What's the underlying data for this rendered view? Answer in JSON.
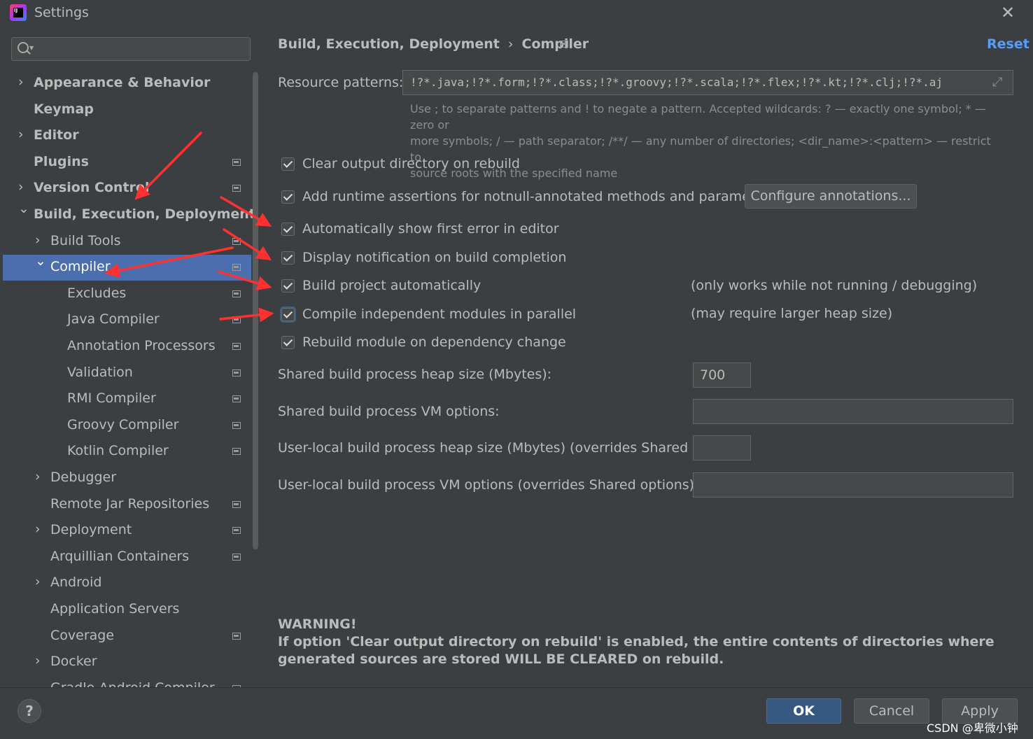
{
  "window": {
    "title": "Settings",
    "logo_text": "IJ"
  },
  "search": {
    "placeholder": "",
    "value": ""
  },
  "sidebar": {
    "items": [
      {
        "label": "Appearance & Behavior",
        "level": 0,
        "chevron": "right",
        "bold": true,
        "project_icon": false,
        "selected": false
      },
      {
        "label": "Keymap",
        "level": 0,
        "chevron": "none",
        "bold": true,
        "project_icon": false,
        "selected": false
      },
      {
        "label": "Editor",
        "level": 0,
        "chevron": "right",
        "bold": true,
        "project_icon": false,
        "selected": false
      },
      {
        "label": "Plugins",
        "level": 0,
        "chevron": "none",
        "bold": true,
        "project_icon": true,
        "selected": false
      },
      {
        "label": "Version Control",
        "level": 0,
        "chevron": "right",
        "bold": true,
        "project_icon": true,
        "selected": false
      },
      {
        "label": "Build, Execution, Deployment",
        "level": 0,
        "chevron": "down",
        "bold": true,
        "project_icon": false,
        "selected": false
      },
      {
        "label": "Build Tools",
        "level": 1,
        "chevron": "right",
        "bold": false,
        "project_icon": true,
        "selected": false
      },
      {
        "label": "Compiler",
        "level": 1,
        "chevron": "down",
        "bold": false,
        "project_icon": true,
        "selected": true
      },
      {
        "label": "Excludes",
        "level": 2,
        "chevron": "none",
        "bold": false,
        "project_icon": true,
        "selected": false
      },
      {
        "label": "Java Compiler",
        "level": 2,
        "chevron": "none",
        "bold": false,
        "project_icon": true,
        "selected": false
      },
      {
        "label": "Annotation Processors",
        "level": 2,
        "chevron": "none",
        "bold": false,
        "project_icon": true,
        "selected": false
      },
      {
        "label": "Validation",
        "level": 2,
        "chevron": "none",
        "bold": false,
        "project_icon": true,
        "selected": false
      },
      {
        "label": "RMI Compiler",
        "level": 2,
        "chevron": "none",
        "bold": false,
        "project_icon": true,
        "selected": false
      },
      {
        "label": "Groovy Compiler",
        "level": 2,
        "chevron": "none",
        "bold": false,
        "project_icon": true,
        "selected": false
      },
      {
        "label": "Kotlin Compiler",
        "level": 2,
        "chevron": "none",
        "bold": false,
        "project_icon": true,
        "selected": false
      },
      {
        "label": "Debugger",
        "level": 1,
        "chevron": "right",
        "bold": false,
        "project_icon": false,
        "selected": false
      },
      {
        "label": "Remote Jar Repositories",
        "level": 1,
        "chevron": "none",
        "bold": false,
        "project_icon": true,
        "selected": false
      },
      {
        "label": "Deployment",
        "level": 1,
        "chevron": "right",
        "bold": false,
        "project_icon": true,
        "selected": false
      },
      {
        "label": "Arquillian Containers",
        "level": 1,
        "chevron": "none",
        "bold": false,
        "project_icon": true,
        "selected": false
      },
      {
        "label": "Android",
        "level": 1,
        "chevron": "right",
        "bold": false,
        "project_icon": false,
        "selected": false
      },
      {
        "label": "Application Servers",
        "level": 1,
        "chevron": "none",
        "bold": false,
        "project_icon": false,
        "selected": false
      },
      {
        "label": "Coverage",
        "level": 1,
        "chevron": "none",
        "bold": false,
        "project_icon": true,
        "selected": false
      },
      {
        "label": "Docker",
        "level": 1,
        "chevron": "right",
        "bold": false,
        "project_icon": false,
        "selected": false
      },
      {
        "label": "Gradle-Android Compiler",
        "level": 1,
        "chevron": "none",
        "bold": false,
        "project_icon": true,
        "selected": false
      }
    ]
  },
  "breadcrumb": {
    "parent": "Build, Execution, Deployment",
    "separator": "›",
    "current": "Compiler"
  },
  "reset_label": "Reset",
  "resource_patterns": {
    "label": "Resource patterns:",
    "value": "!?*.java;!?*.form;!?*.class;!?*.groovy;!?*.scala;!?*.flex;!?*.kt;!?*.clj;!?*.aj",
    "help_line1": "Use ; to separate patterns and ! to negate a pattern. Accepted wildcards: ? — exactly one symbol; * — zero or",
    "help_line2": "more symbols; / — path separator; /**/ — any number of directories; <dir_name>:<pattern> — restrict to",
    "help_line3": "source roots with the specified name"
  },
  "options": [
    {
      "label": "Clear output directory on rebuild",
      "checked": true,
      "note": ""
    },
    {
      "label": "Add runtime assertions for notnull-annotated methods and parameters",
      "checked": true,
      "note": ""
    },
    {
      "label": "Automatically show first error in editor",
      "checked": true,
      "note": ""
    },
    {
      "label": "Display notification on build completion",
      "checked": true,
      "note": ""
    },
    {
      "label": "Build project automatically",
      "checked": true,
      "note": "(only works while not running / debugging)"
    },
    {
      "label": "Compile independent modules in parallel",
      "checked": true,
      "note": "(may require larger heap size)"
    },
    {
      "label": "Rebuild module on dependency change",
      "checked": true,
      "note": ""
    }
  ],
  "configure_button": "Configure annotations...",
  "fields": {
    "shared_heap": {
      "label": "Shared build process heap size (Mbytes):",
      "value": "700"
    },
    "shared_vm": {
      "label": "Shared build process VM options:",
      "value": ""
    },
    "local_heap": {
      "label": "User-local build process heap size (Mbytes) (overrides Shared size):",
      "value": ""
    },
    "local_vm": {
      "label": "User-local build process VM options (overrides Shared options):",
      "value": ""
    }
  },
  "warning": {
    "title": "WARNING!",
    "text": "If option 'Clear output directory on rebuild' is enabled, the entire contents of directories where generated sources are stored WILL BE CLEARED on rebuild."
  },
  "footer": {
    "help": "?",
    "ok": "OK",
    "cancel": "Cancel",
    "apply": "Apply"
  },
  "watermark": "CSDN @卑微小钟",
  "colors": {
    "background": "#3c3f41",
    "selection": "#4b6eaf",
    "accent_link": "#589df6",
    "ok_button": "#365880",
    "annotation_arrow": "#ff3030"
  }
}
